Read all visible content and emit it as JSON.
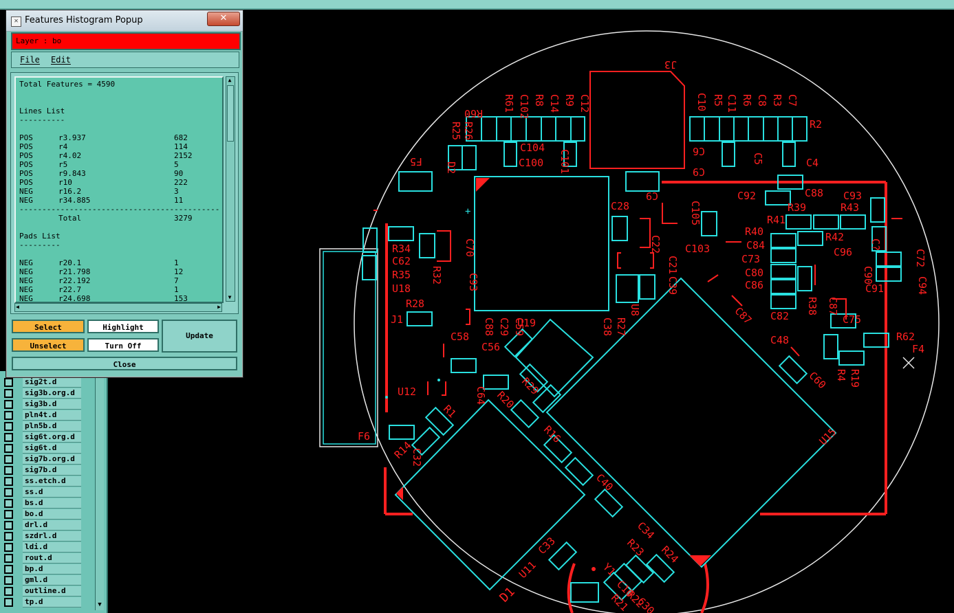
{
  "popup": {
    "title": "Features Histogram Popup",
    "close_glyph": "✕",
    "layer_label": "Layer :  bo",
    "menu": [
      "File",
      "Edit"
    ],
    "histogram": {
      "total": "Total Features = 4590",
      "lines_header": "Lines List",
      "underline_short": "----------",
      "lines": [
        [
          "POS",
          "r3.937",
          "682"
        ],
        [
          "POS",
          "r4",
          "114"
        ],
        [
          "POS",
          "r4.02",
          "2152"
        ],
        [
          "POS",
          "r5",
          "5"
        ],
        [
          "POS",
          "r9.843",
          "90"
        ],
        [
          "POS",
          "r10",
          "222"
        ],
        [
          "NEG",
          "r16.2",
          "3"
        ],
        [
          "NEG",
          "r34.885",
          "11"
        ]
      ],
      "separator": "--------------------------------------------",
      "lines_total_label": "Total",
      "lines_total_value": "3279",
      "pads_header": "Pads List",
      "pads_underline": "---------",
      "pads": [
        [
          "NEG",
          "r20.1",
          "1"
        ],
        [
          "NEG",
          "r21.798",
          "12"
        ],
        [
          "NEG",
          "r22.192",
          "7"
        ],
        [
          "NEG",
          "r22.7",
          "1"
        ],
        [
          "NEG",
          "r24.698",
          "153"
        ]
      ]
    },
    "buttons": {
      "select": "Select",
      "unselect": "Unselect",
      "highlight": "Highlight",
      "turn_off": "Turn Off",
      "update": "Update",
      "close": "Close"
    }
  },
  "layers": [
    "sig2t.d",
    "sig3b.org.d",
    "sig3b.d",
    "pln4t.d",
    "pln5b.d",
    "sig6t.org.d",
    "sig6t.d",
    "sig7b.org.d",
    "sig7b.d",
    "ss.etch.d",
    "ss.d",
    "bs.d",
    "bo.d",
    "drl.d",
    "szdrl.d",
    "ldi.d",
    "rout.d",
    "bp.d",
    "gml.d",
    "outline.d",
    "tp.d"
  ],
  "pcb_labels": [
    "J3",
    "C10",
    "R5",
    "C11",
    "R6",
    "C8",
    "R3",
    "C7",
    "R2",
    "R60",
    "R61",
    "C102",
    "R8",
    "C14",
    "R9",
    "C12",
    "R25",
    "R26",
    "C104",
    "C101",
    "C100",
    "C6",
    "C5",
    "C4",
    "F5",
    "D2",
    "C9",
    "C28",
    "C105",
    "C103",
    "C92",
    "C93",
    "R39",
    "R43",
    "R41",
    "R42",
    "R40",
    "C84",
    "C73",
    "C80",
    "C86",
    "R38",
    "C82",
    "C96",
    "C90",
    "C74",
    "C87",
    "C95",
    "C94",
    "C75",
    "C72",
    "R62",
    "F4",
    "R34",
    "C62",
    "R32",
    "C70",
    "R35",
    "U18",
    "C93",
    "C27",
    "C22",
    "C21",
    "R28",
    "J1",
    "C58",
    "U19",
    "C88",
    "C29",
    "C59",
    "C56",
    "R27",
    "U8",
    "C38",
    "C87",
    "C48",
    "C60",
    "R19",
    "R4",
    "U12",
    "C64",
    "R20",
    "R29",
    "R16",
    "R14",
    "C39",
    "F6",
    "U15",
    "C40",
    "C33",
    "U11",
    "C34",
    "R23",
    "R24",
    "Y1",
    "R21",
    "R22",
    "D1",
    "C48",
    "C30",
    "C20"
  ],
  "colors": {
    "copper": "#ff2020",
    "outline": "#29e0e0",
    "board": "#e8e8e8",
    "panel": "#7fcabd",
    "highlight_btn": "#f7b33b"
  }
}
